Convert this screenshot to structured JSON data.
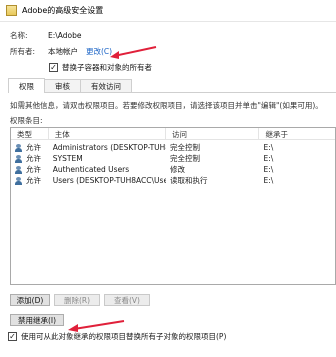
{
  "window": {
    "title": "Adobe的高级安全设置"
  },
  "name_row": {
    "label": "名称:",
    "value": "E:\\Adobe"
  },
  "owner_row": {
    "label": "所有者:",
    "value": "本地帐户",
    "change_link": "更改(C)"
  },
  "replace_owner": {
    "label": "替换子容器和对象的所有者",
    "checked": true
  },
  "tabs": [
    {
      "label": "权限",
      "active": true
    },
    {
      "label": "审核",
      "active": false
    },
    {
      "label": "有效访问",
      "active": false
    }
  ],
  "info_text": "如需其他信息，请双击权限项目。若要修改权限项目，请选择该项目并单击\"编辑\"(如果可用)。",
  "entries_label": "权限条目:",
  "table": {
    "headers": {
      "type": "类型",
      "subject": "主体",
      "access": "访问",
      "inherit": "继承于"
    },
    "rows": [
      {
        "type": "允许",
        "subject": "Administrators (DESKTOP-TUH8...",
        "access": "完全控制",
        "inherit": "E:\\"
      },
      {
        "type": "允许",
        "subject": "SYSTEM",
        "access": "完全控制",
        "inherit": "E:\\"
      },
      {
        "type": "允许",
        "subject": "Authenticated Users",
        "access": "修改",
        "inherit": "E:\\"
      },
      {
        "type": "允许",
        "subject": "Users (DESKTOP-TUH8ACC\\Users)",
        "access": "读取和执行",
        "inherit": "E:\\"
      }
    ]
  },
  "buttons": {
    "add": "添加(D)",
    "remove": "删除(R)",
    "view": "查看(V)",
    "disable_inheritance": "禁用继承(I)"
  },
  "replace_child_permissions": {
    "label": "使用可从此对象继承的权限项目替换所有子对象的权限项目(P)",
    "checked": true
  },
  "accent_colors": {
    "annotation_arrow": "#e0203a",
    "link": "#1a63c6"
  }
}
